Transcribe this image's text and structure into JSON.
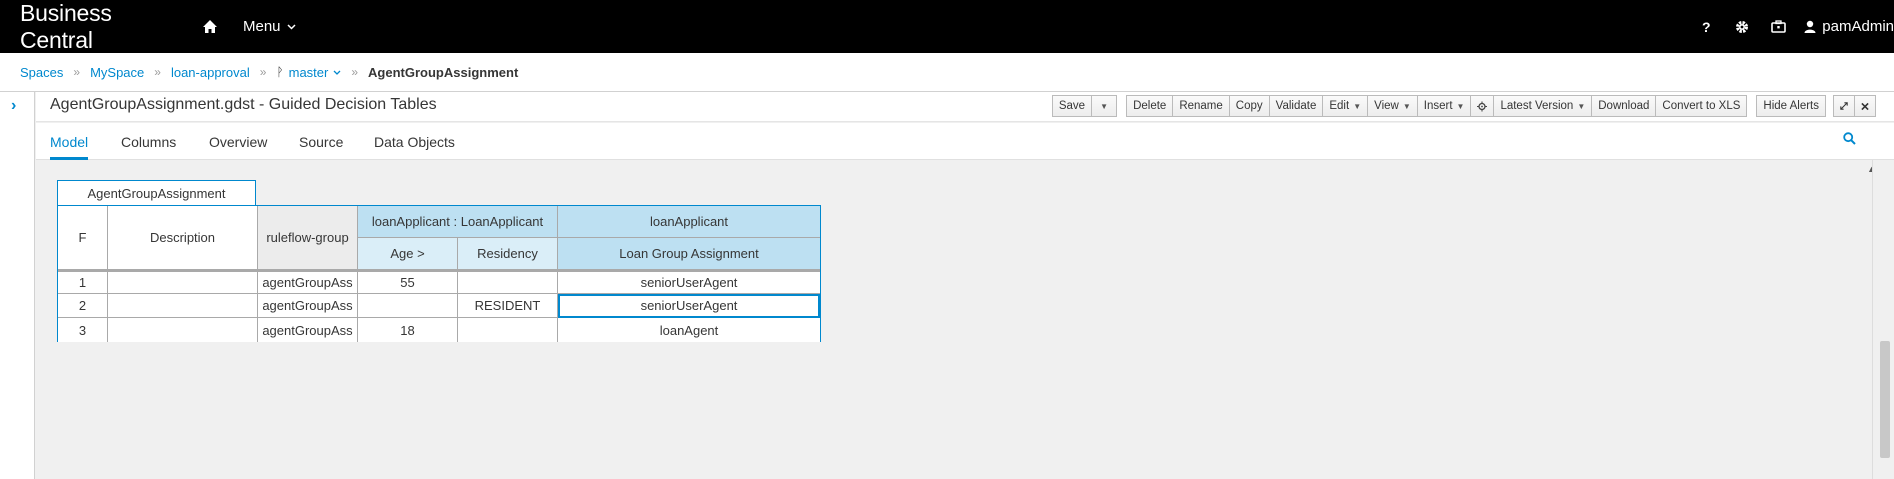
{
  "navbar": {
    "brand": "Business Central",
    "menu_label": "Menu",
    "help_label": "?",
    "user": "pamAdmin"
  },
  "breadcrumb": {
    "items": [
      "Spaces",
      "MySpace",
      "loan-approval"
    ],
    "branch": "master",
    "current": "AgentGroupAssignment"
  },
  "editor": {
    "title": "AgentGroupAssignment.gdst - Guided Decision Tables",
    "toolbar": {
      "save": "Save",
      "delete": "Delete",
      "rename": "Rename",
      "copy": "Copy",
      "validate": "Validate",
      "edit": "Edit",
      "view": "View",
      "insert": "Insert",
      "latest_version": "Latest Version",
      "download": "Download",
      "convert": "Convert to XLS",
      "hide_alerts": "Hide Alerts"
    },
    "tabs": [
      "Model",
      "Columns",
      "Overview",
      "Source",
      "Data Objects"
    ]
  },
  "decision_table": {
    "name": "AgentGroupAssignment",
    "headers": {
      "row_number": "F",
      "description": "Description",
      "ruleflow": "ruleflow-group",
      "condition_pattern": "loanApplicant : LoanApplicant",
      "condition_age": "Age >",
      "condition_residency": "Residency",
      "action_pattern": "loanApplicant",
      "action_field": "Loan Group Assignment"
    },
    "rows": [
      {
        "num": "1",
        "description": "",
        "ruleflow": "agentGroupAss",
        "age": "55",
        "residency": "",
        "assignment": "seniorUserAgent"
      },
      {
        "num": "2",
        "description": "",
        "ruleflow": "agentGroupAss",
        "age": "",
        "residency": "RESIDENT",
        "assignment": "seniorUserAgent"
      },
      {
        "num": "3",
        "description": "",
        "ruleflow": "agentGroupAss",
        "age": "18",
        "residency": "",
        "assignment": "loanAgent"
      }
    ]
  },
  "colors": {
    "accent": "#0088ce",
    "header_blue": "#bde0f2",
    "header_light_blue": "#daeef8"
  }
}
